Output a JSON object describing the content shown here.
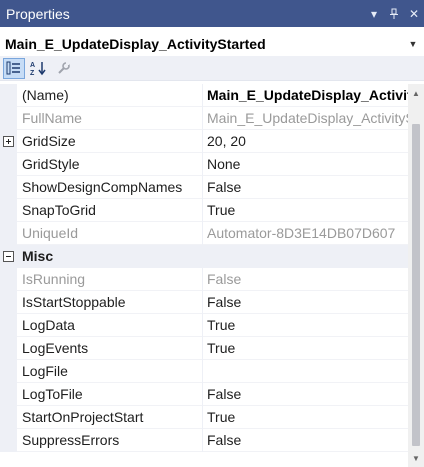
{
  "panel": {
    "title": "Properties",
    "dropdown_glyph": "▾",
    "pin_glyph": "⊥",
    "close_glyph": "✕"
  },
  "object_selector": {
    "selected": "Main_E_UpdateDisplay_ActivityStarted"
  },
  "toolbar": {
    "buttons": [
      {
        "name": "categorized-icon",
        "active": true
      },
      {
        "name": "alphabetical-icon",
        "active": false
      },
      {
        "name": "property-pages-wrench-icon",
        "active": false
      }
    ]
  },
  "grid": {
    "rows": [
      {
        "kind": "prop",
        "name": "(Name)",
        "value": "Main_E_UpdateDisplay_ActivityStarted",
        "state": "selected"
      },
      {
        "kind": "prop",
        "name": "FullName",
        "value": "Main_E_UpdateDisplay_ActivityStarted",
        "state": "readonly"
      },
      {
        "kind": "prop",
        "name": "GridSize",
        "value": "20, 20",
        "expandable": true
      },
      {
        "kind": "prop",
        "name": "GridStyle",
        "value": "None"
      },
      {
        "kind": "prop",
        "name": "ShowDesignCompNames",
        "value": "False"
      },
      {
        "kind": "prop",
        "name": "SnapToGrid",
        "value": "True"
      },
      {
        "kind": "prop",
        "name": "UniqueId",
        "value": "Automator-8D3E14DB07D607",
        "state": "readonly"
      },
      {
        "kind": "category",
        "name": "Misc"
      },
      {
        "kind": "prop",
        "name": "IsRunning",
        "value": "False",
        "state": "readonly"
      },
      {
        "kind": "prop",
        "name": "IsStartStoppable",
        "value": "False"
      },
      {
        "kind": "prop",
        "name": "LogData",
        "value": "True"
      },
      {
        "kind": "prop",
        "name": "LogEvents",
        "value": "True"
      },
      {
        "kind": "prop",
        "name": "LogFile",
        "value": ""
      },
      {
        "kind": "prop",
        "name": "LogToFile",
        "value": "False"
      },
      {
        "kind": "prop",
        "name": "StartOnProjectStart",
        "value": "True"
      },
      {
        "kind": "prop",
        "name": "SuppressErrors",
        "value": "False"
      }
    ]
  },
  "scrollbar": {
    "up_glyph": "▲",
    "down_glyph": "▼"
  }
}
